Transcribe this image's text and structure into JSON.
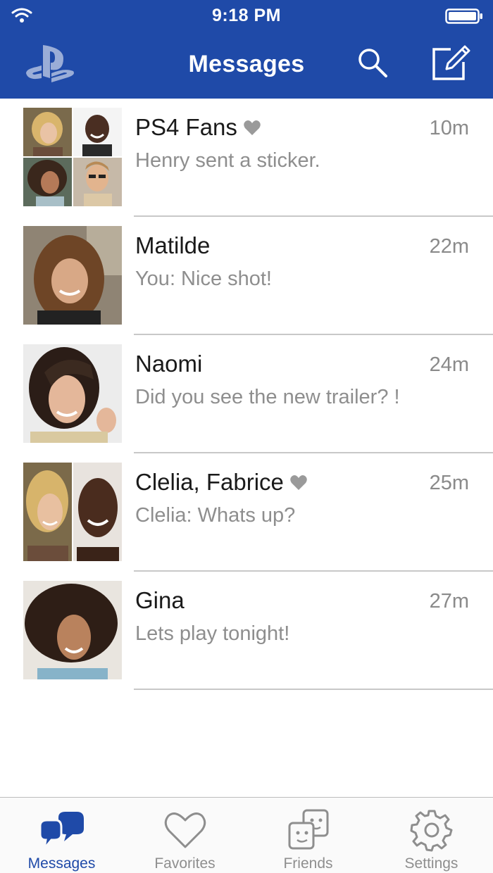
{
  "status_bar": {
    "time": "9:18 PM"
  },
  "header": {
    "title": "Messages"
  },
  "conversations": [
    {
      "title": "PS4 Fans",
      "favorite": true,
      "time": "10m",
      "preview": "Henry sent a sticker.",
      "avatar_type": "group-of-4"
    },
    {
      "title": "Matilde",
      "favorite": false,
      "time": "22m",
      "preview": "You: Nice shot!",
      "avatar_type": "single"
    },
    {
      "title": "Naomi",
      "favorite": false,
      "time": "24m",
      "preview": "Did you see the new trailer? !",
      "avatar_type": "single"
    },
    {
      "title": "Clelia, Fabrice",
      "favorite": true,
      "time": "25m",
      "preview": "Clelia: Whats up?",
      "avatar_type": "group-of-2"
    },
    {
      "title": "Gina",
      "favorite": false,
      "time": "27m",
      "preview": "Lets play tonight!",
      "avatar_type": "single"
    }
  ],
  "tabs": [
    {
      "label": "Messages",
      "icon": "messages-icon",
      "active": true
    },
    {
      "label": "Favorites",
      "icon": "heart-icon",
      "active": false
    },
    {
      "label": "Friends",
      "icon": "friends-icon",
      "active": false
    },
    {
      "label": "Settings",
      "icon": "gear-icon",
      "active": false
    }
  ],
  "colors": {
    "header_bg": "#1f4aa8",
    "accent": "#1f4aa8",
    "text_primary": "#1a1a1a",
    "text_secondary": "#8e8e8e",
    "divider": "#c8c8c8"
  }
}
